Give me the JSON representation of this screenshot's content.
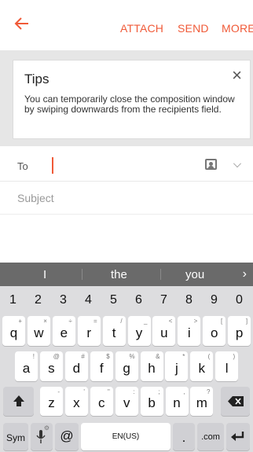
{
  "toolbar": {
    "back_icon": "back-arrow-icon",
    "attach": "ATTACH",
    "send": "SEND",
    "more": "MORE",
    "accent": "#f05a38"
  },
  "tips": {
    "title": "Tips",
    "body": "You can temporarily close the composition window by swiping downwards from the recipients field."
  },
  "compose": {
    "to_label": "To",
    "subject_placeholder": "Subject"
  },
  "keyboard": {
    "suggestions": [
      "I",
      "the",
      "you"
    ],
    "numbers": [
      "1",
      "2",
      "3",
      "4",
      "5",
      "6",
      "7",
      "8",
      "9",
      "0"
    ],
    "row1": [
      "q",
      "w",
      "e",
      "r",
      "t",
      "y",
      "u",
      "i",
      "o",
      "p"
    ],
    "row1_sub": [
      "+",
      "×",
      "÷",
      "=",
      "/",
      "_",
      "<",
      ">",
      "[",
      "]"
    ],
    "row2": [
      "a",
      "s",
      "d",
      "f",
      "g",
      "h",
      "j",
      "k",
      "l"
    ],
    "row2_sub": [
      "!",
      "@",
      "#",
      "$",
      "%",
      "&",
      "*",
      "(",
      ")"
    ],
    "row3": [
      "z",
      "x",
      "c",
      "v",
      "b",
      "n",
      "m"
    ],
    "row3_sub": [
      "-",
      "'",
      "\"",
      ":",
      ";",
      ",",
      "?"
    ],
    "sym": "Sym",
    "lang": "EN(US)",
    "dot": ".",
    "com": ".com",
    "mic_sub": "⚙",
    "at": "@"
  }
}
